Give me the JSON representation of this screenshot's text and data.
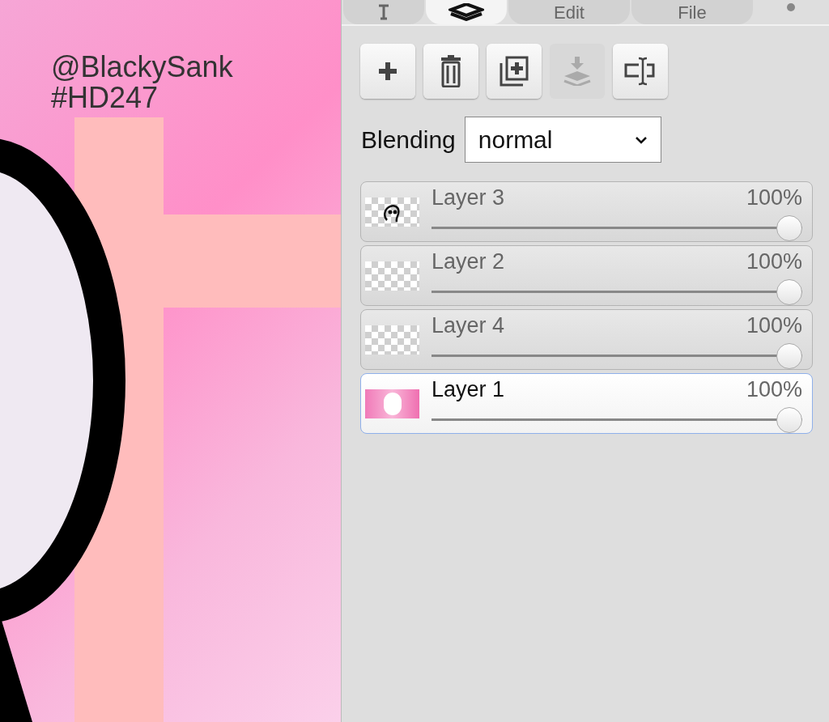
{
  "canvas": {
    "text_lines": [
      "@BlackySank",
      "#HD247"
    ]
  },
  "tabs": [
    {
      "kind": "text-tool",
      "selected": false
    },
    {
      "kind": "layers",
      "selected": true
    },
    {
      "kind": "text",
      "label": "Edit",
      "selected": false
    },
    {
      "kind": "text",
      "label": "File",
      "selected": false
    }
  ],
  "toolbar": [
    {
      "kind": "add",
      "disabled": false
    },
    {
      "kind": "delete",
      "disabled": false
    },
    {
      "kind": "duplicate",
      "disabled": false
    },
    {
      "kind": "merge-down",
      "disabled": true
    },
    {
      "kind": "rename",
      "disabled": false
    }
  ],
  "blending": {
    "label": "Blending",
    "value": "normal"
  },
  "layers": [
    {
      "name": "Layer 3",
      "opacity": "100%",
      "level": 1,
      "selected": false,
      "kind": "figure"
    },
    {
      "name": "Layer 2",
      "opacity": "100%",
      "level": 1,
      "selected": false,
      "kind": "empty"
    },
    {
      "name": "Layer 4",
      "opacity": "100%",
      "level": 1,
      "selected": false,
      "kind": "empty"
    },
    {
      "name": "Layer 1",
      "opacity": "100%",
      "level": 1,
      "selected": true,
      "kind": "pink"
    }
  ]
}
